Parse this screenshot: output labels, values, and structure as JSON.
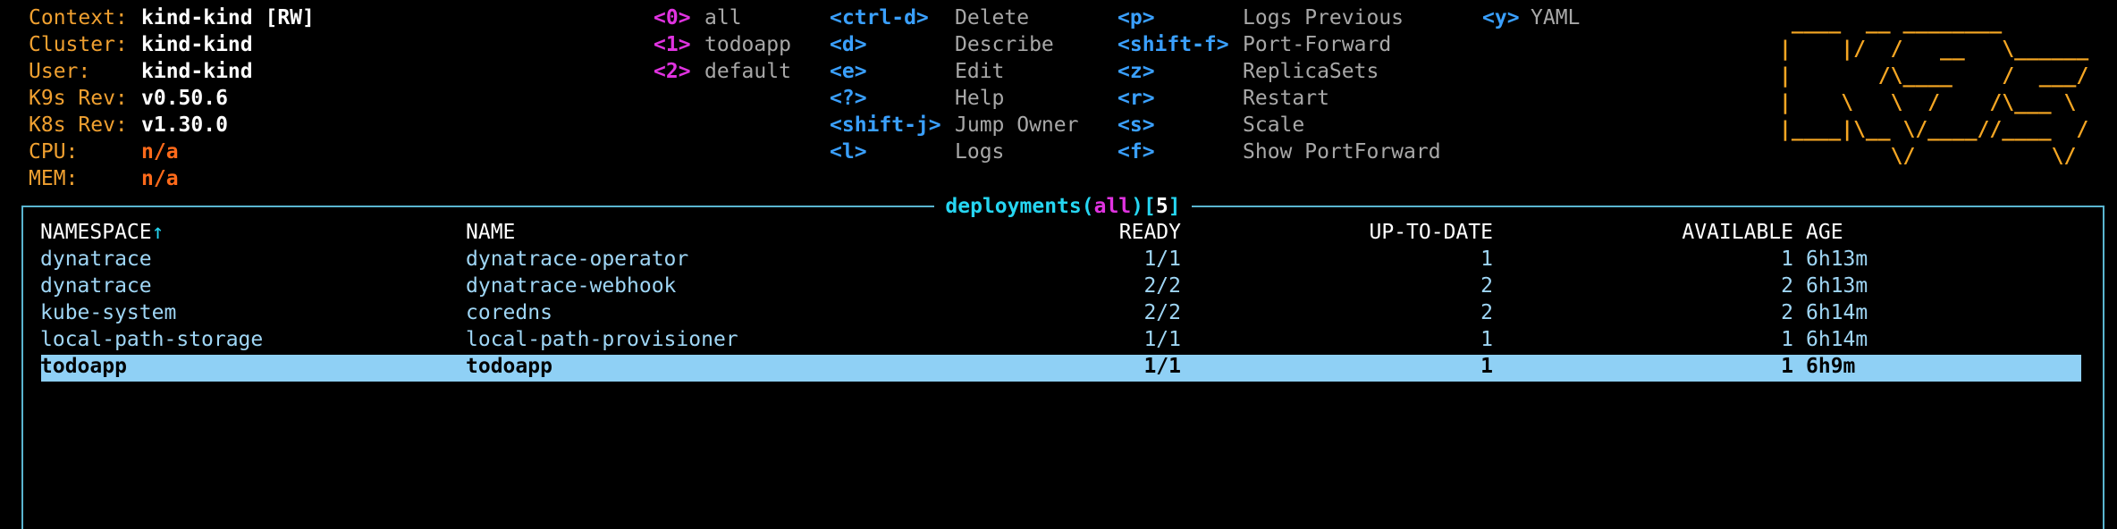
{
  "info": [
    {
      "label": "Context:",
      "value": "kind-kind [RW]",
      "style": "value"
    },
    {
      "label": "Cluster:",
      "value": "kind-kind",
      "style": "value"
    },
    {
      "label": "User:",
      "value": "kind-kind",
      "style": "value"
    },
    {
      "label": "K9s Rev:",
      "value": "v0.50.6",
      "style": "value"
    },
    {
      "label": "K8s Rev:",
      "value": "v1.30.0",
      "style": "value"
    },
    {
      "label": "CPU:",
      "value": "n/a",
      "style": "na"
    },
    {
      "label": "MEM:",
      "value": "n/a",
      "style": "na"
    }
  ],
  "namespaces": [
    {
      "key": "<0>",
      "name": "all"
    },
    {
      "key": "<1>",
      "name": "todoapp"
    },
    {
      "key": "<2>",
      "name": "default"
    }
  ],
  "commands_col1": [
    {
      "key": "<ctrl-d>",
      "label": "Delete"
    },
    {
      "key": "<d>",
      "label": "Describe"
    },
    {
      "key": "<e>",
      "label": "Edit"
    },
    {
      "key": "<?>",
      "label": "Help"
    },
    {
      "key": "<shift-j>",
      "label": "Jump Owner"
    },
    {
      "key": "<l>",
      "label": "Logs"
    }
  ],
  "commands_col2": [
    {
      "key": "<p>",
      "label": "Logs Previous"
    },
    {
      "key": "<shift-f>",
      "label": "Port-Forward"
    },
    {
      "key": "<z>",
      "label": "ReplicaSets"
    },
    {
      "key": "<r>",
      "label": "Restart"
    },
    {
      "key": "<s>",
      "label": "Scale"
    },
    {
      "key": "<f>",
      "label": "Show PortForward"
    }
  ],
  "commands_col3": [
    {
      "key": "<y>",
      "label": "YAML"
    }
  ],
  "logo": " ____  __ ________       \n|    |/  /   __   \\______\n|       /\\____    /  ___/\n|    \\   \\  /    /\\___ \\ \n|____|\\__ \\/____//____  /\n         \\/           \\/ ",
  "table": {
    "resource": "deployments",
    "filter": "all",
    "count": "5",
    "headers": {
      "namespace": "NAMESPACE",
      "sort_arrow": "↑",
      "name": "NAME",
      "ready": "READY",
      "uptodate": "UP-TO-DATE",
      "available": "AVAILABLE",
      "age": "AGE"
    },
    "rows": [
      {
        "namespace": "dynatrace",
        "name": "dynatrace-operator",
        "ready": "1/1",
        "uptodate": "1",
        "available": "1",
        "age": "6h13m"
      },
      {
        "namespace": "dynatrace",
        "name": "dynatrace-webhook",
        "ready": "2/2",
        "uptodate": "2",
        "available": "2",
        "age": "6h13m"
      },
      {
        "namespace": "kube-system",
        "name": "coredns",
        "ready": "2/2",
        "uptodate": "2",
        "available": "2",
        "age": "6h14m"
      },
      {
        "namespace": "local-path-storage",
        "name": "local-path-provisioner",
        "ready": "1/1",
        "uptodate": "1",
        "available": "1",
        "age": "6h14m"
      },
      {
        "namespace": "todoapp",
        "name": "todoapp",
        "ready": "1/1",
        "uptodate": "1",
        "available": "1",
        "age": "6h9m",
        "selected": true
      }
    ]
  }
}
